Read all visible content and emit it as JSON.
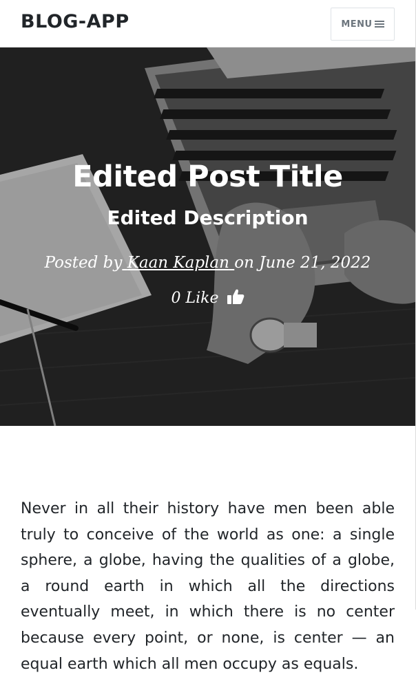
{
  "navbar": {
    "brand": "BLOG-APP",
    "menu_label": "MENU",
    "menu_icon": "bars-icon"
  },
  "hero": {
    "title": "Edited Post Title",
    "subtitle": "Edited Description",
    "posted_by_prefix": "Posted by",
    "author": "Kaan Kaplan",
    "date_prefix": "on",
    "date": "June 21, 2022",
    "like_count": "0",
    "like_label": "Like",
    "like_icon": "thumbs-up-icon"
  },
  "article": {
    "body": "Never in all their history have men been able truly to conceive of the world as one: a single sphere, a globe, having the qualities of a globe, a round earth in which all the directions eventually meet, in which there is no center because every point, or none, is center — an equal earth which all men occupy as equals."
  },
  "colors": {
    "text": "#212529",
    "muted": "#6c757d",
    "hero_text": "#ffffff"
  }
}
